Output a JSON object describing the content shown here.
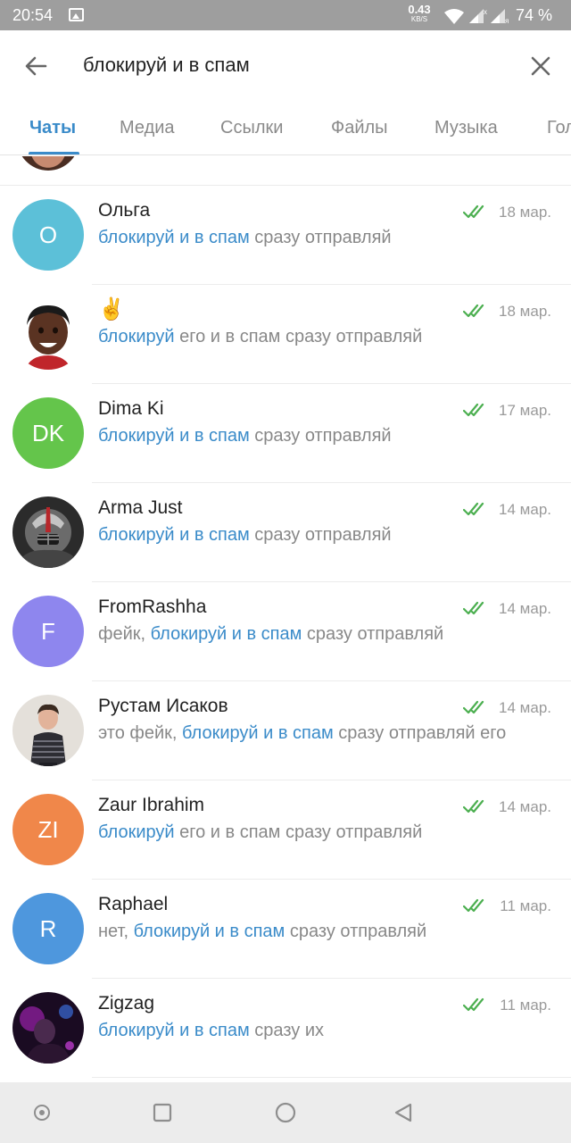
{
  "status_bar": {
    "time": "20:54",
    "speed_value": "0.43",
    "speed_unit": "KB/S",
    "battery": "74 %"
  },
  "search": {
    "query": "блокируй и в спам"
  },
  "tabs": [
    {
      "label": "Чаты",
      "active": true
    },
    {
      "label": "Медиа",
      "active": false
    },
    {
      "label": "Ссылки",
      "active": false
    },
    {
      "label": "Файлы",
      "active": false
    },
    {
      "label": "Музыка",
      "active": false
    },
    {
      "label": "Гол",
      "active": false
    }
  ],
  "colors": {
    "accent": "#3a8bc9",
    "check": "#4caf50"
  },
  "chats": [
    {
      "name": "Ольга",
      "initials": "О",
      "avatar_color": "#5cc0d8",
      "date": "18 мар.",
      "msg_pre": "",
      "msg_hl": "блокируй и в спам",
      "msg_post": " сразу отправляй"
    },
    {
      "name": "✌️",
      "initials": "",
      "avatar_color": "#ffffff",
      "date": "18 мар.",
      "msg_pre": "",
      "msg_hl": "блокируй",
      "msg_post": " его и в спам сразу отправляй"
    },
    {
      "name": "Dima Ki",
      "initials": "DK",
      "avatar_color": "#64c54b",
      "date": "17 мар.",
      "msg_pre": "",
      "msg_hl": "блокируй и в спам",
      "msg_post": " сразу отправляй"
    },
    {
      "name": "Arma Just",
      "initials": "",
      "avatar_color": "#3a3a3a",
      "date": "14 мар.",
      "msg_pre": "",
      "msg_hl": "блокируй и в спам",
      "msg_post": " сразу отправляй"
    },
    {
      "name": "FromRashha",
      "initials": "F",
      "avatar_color": "#8e86ee",
      "date": "14 мар.",
      "msg_pre": "фейк, ",
      "msg_hl": "блокируй и в спам",
      "msg_post": " сразу отправляй"
    },
    {
      "name": "Рустам Исаков",
      "initials": "",
      "avatar_color": "#d9d4cf",
      "date": "14 мар.",
      "msg_pre": "это фейк, ",
      "msg_hl": "блокируй и в спам",
      "msg_post": " сразу отправляй его"
    },
    {
      "name": "Zaur Ibrahim",
      "initials": "ZI",
      "avatar_color": "#f0874a",
      "date": "14 мар.",
      "msg_pre": "",
      "msg_hl": "блокируй",
      "msg_post": " его и в спам сразу отправляй"
    },
    {
      "name": "Raphael",
      "initials": "R",
      "avatar_color": "#4e97dd",
      "date": "11 мар.",
      "msg_pre": "нет, ",
      "msg_hl": "блокируй и в спам",
      "msg_post": " сразу отправляй"
    },
    {
      "name": "Zigzag",
      "initials": "",
      "avatar_color": "#2a1030",
      "date": "11 мар.",
      "msg_pre": "",
      "msg_hl": "блокируй и в спам",
      "msg_post": " сразу их"
    }
  ]
}
